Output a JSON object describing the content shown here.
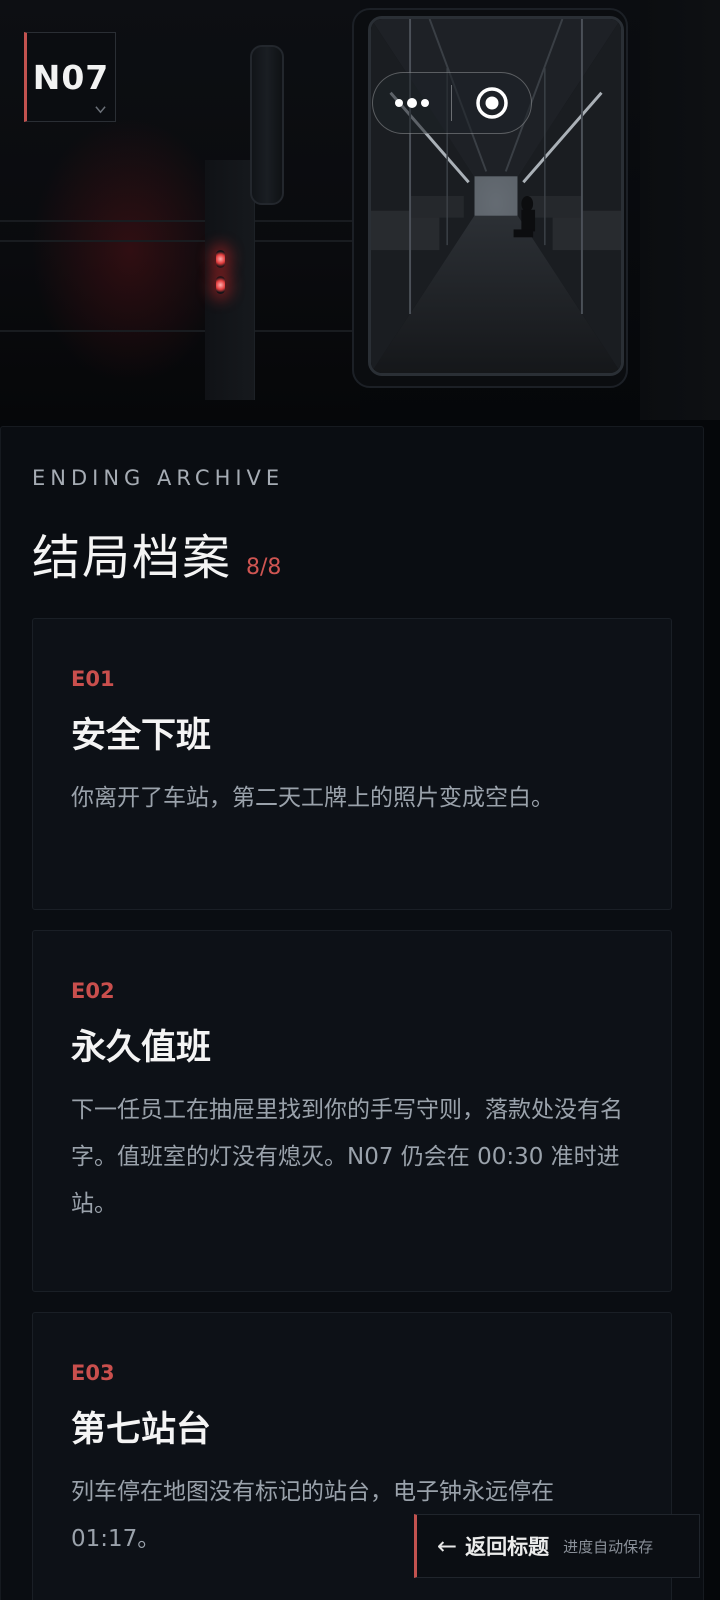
{
  "logo": {
    "text": "N07"
  },
  "capsule": {
    "more_icon": "more-dots-icon",
    "close_icon": "target-circle-icon"
  },
  "archive": {
    "eyebrow": "ENDING ARCHIVE",
    "title": "结局档案",
    "count": "8/8",
    "endings": [
      {
        "code": "E01",
        "title": "安全下班",
        "desc": "你离开了车站，第二天工牌上的照片变成空白。"
      },
      {
        "code": "E02",
        "title": "永久值班",
        "desc": "下一任员工在抽屉里找到你的手写守则，落款处没有名字。值班室的灯没有熄灭。N07 仍会在 00:30 准时进站。"
      },
      {
        "code": "E03",
        "title": "第七站台",
        "desc": "列车停在地图没有标记的站台，电子钟永远停在 01:17。"
      }
    ]
  },
  "footer": {
    "back_arrow": "←",
    "back_label": "返回标题",
    "save_hint": "进度自动保存"
  },
  "colors": {
    "accent": "#c94f4d",
    "background": "#05070a",
    "card": "#0d1117"
  }
}
